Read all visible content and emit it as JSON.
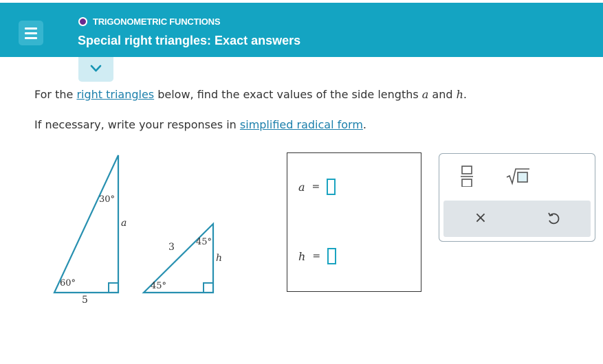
{
  "header": {
    "topic": "TRIGONOMETRIC FUNCTIONS",
    "title": "Special right triangles: Exact answers",
    "colors": {
      "bar": "#14a4c2",
      "topic_dot": "#6a2a8f"
    }
  },
  "instructions": {
    "line1": {
      "before": "For the ",
      "link": "right triangles",
      "middle": " below, find the exact values of the side lengths ",
      "var1": "a",
      "and": " and ",
      "var2": "h",
      "end": "."
    },
    "line2": {
      "before": "If necessary, write your responses in ",
      "link": "simplified radical form",
      "end": "."
    }
  },
  "figure": {
    "triangle1": {
      "top_angle": "30°",
      "bottom_angle": "60°",
      "base": "5",
      "side": "a"
    },
    "triangle2": {
      "top_angle": "45°",
      "bottom_angle": "45°",
      "hypotenuse": "3",
      "side": "h"
    }
  },
  "answers": {
    "a": {
      "label": "a",
      "eq": "=",
      "value": ""
    },
    "h": {
      "label": "h",
      "eq": "=",
      "value": ""
    }
  },
  "toolbar": {
    "icons": [
      "fraction-icon",
      "sqrt-icon",
      "clear-icon",
      "undo-icon"
    ],
    "clear_glyph": "×"
  },
  "colors": {
    "triangle_stroke": "#2790b0",
    "link": "#1b7fab",
    "input_border": "#1aa3c0"
  }
}
